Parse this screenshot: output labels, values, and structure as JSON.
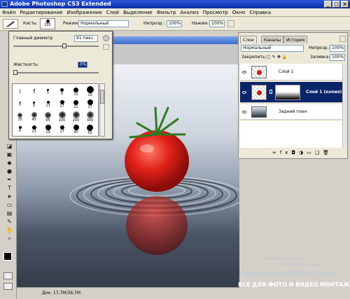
{
  "window": {
    "title": "Adobe Photoshop CS3 Extended",
    "buttons": [
      "_",
      "□",
      "×"
    ]
  },
  "menu": [
    "Файл",
    "Редактирование",
    "Изображение",
    "Слой",
    "Выделение",
    "Фильтр",
    "Анализ",
    "Просмотр",
    "Окно",
    "Справка"
  ],
  "options": {
    "brush_label": "Кисть:",
    "brush_size": "205",
    "mode_label": "Режим:",
    "mode_value": "Нормальный",
    "opacity_label": "Непрозр.:",
    "opacity_value": "100%",
    "flow_label": "Нажим:",
    "flow_value": "100%"
  },
  "brush_popup": {
    "diameter_label": "Главный диаметр",
    "diameter_value": "91 пикс.",
    "diameter_level": 0.6,
    "hardness_label": "Жесткость:",
    "hardness_value": "0%",
    "hardness_level": 0.0,
    "presets": [
      {
        "size": 1,
        "r": 0.5
      },
      {
        "size": 3,
        "r": 1
      },
      {
        "size": 5,
        "r": 1.5
      },
      {
        "size": 9,
        "r": 2.5
      },
      {
        "size": 13,
        "r": 3.5
      },
      {
        "size": 19,
        "r": 5
      },
      {
        "size": 5,
        "r": 1
      },
      {
        "size": 9,
        "r": 1.5
      },
      {
        "size": 13,
        "r": 2
      },
      {
        "size": 17,
        "r": 3
      },
      {
        "size": 21,
        "r": 3.5
      },
      {
        "size": 27,
        "r": 4
      },
      {
        "size": 35,
        "r": 3.5
      },
      {
        "size": 45,
        "r": 4
      },
      {
        "size": 65,
        "r": 4.5
      },
      {
        "size": 100,
        "r": 5
      },
      {
        "size": 200,
        "r": 5
      },
      {
        "size": 300,
        "r": 5
      },
      {
        "size": 9,
        "r": 2
      },
      {
        "size": 13,
        "r": 3
      },
      {
        "size": 19,
        "r": 4
      },
      {
        "size": 17,
        "r": 3
      },
      {
        "size": 45,
        "r": 4
      },
      {
        "size": 65,
        "r": 4.5
      }
    ]
  },
  "layers_panel": {
    "tabs": [
      "Слои",
      "Каналы",
      "История"
    ],
    "blend_mode": "Нормальный",
    "opacity_label": "Непрозр.:",
    "opacity_value": "100%",
    "lock_label": "Закрепить:",
    "fill_label": "Заливка:",
    "fill_value": "100%",
    "layers": [
      {
        "name": "Слой 1",
        "selected": false
      },
      {
        "name": "Слой 1 (копия)",
        "selected": true
      },
      {
        "name": "Задний план",
        "selected": false
      }
    ],
    "footer_icons": [
      "link-icon",
      "fx-icon",
      "mask-icon",
      "adjust-icon",
      "folder-icon",
      "new-layer-icon",
      "trash-icon"
    ]
  },
  "status": {
    "doc_info": "Док: 17,7M/39,7M"
  },
  "watermark": {
    "author": "Авторы Лукьянова",
    "site_small": "www.photoshop-master.ru",
    "site": "fotovideoeffect.com",
    "slogan": "ВСЕ ДЛЯ ФОТО И ВИДЕО МОНТАЖА!"
  },
  "colors": {
    "title": "#0b2fa8",
    "selection": "#0a246a",
    "tomato": "#d81b14"
  }
}
